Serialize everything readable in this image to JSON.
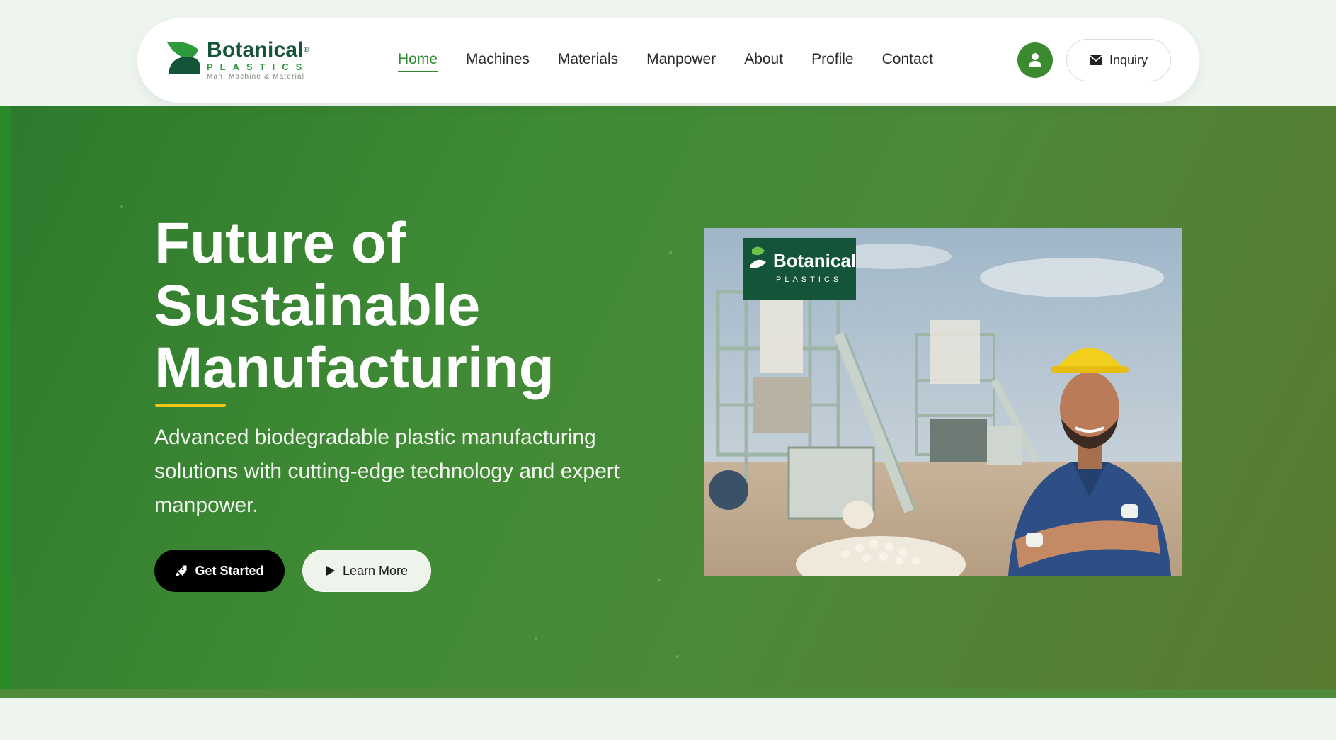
{
  "brand": {
    "name": "Botanical",
    "registered_mark": "®",
    "sub": "PLASTICS",
    "tagline": "Man, Machine & Material",
    "color_primary": "#16553a",
    "color_accent": "#2e9a3d"
  },
  "nav": {
    "items": [
      {
        "label": "Home",
        "active": true
      },
      {
        "label": "Machines",
        "active": false
      },
      {
        "label": "Materials",
        "active": false
      },
      {
        "label": "Manpower",
        "active": false
      },
      {
        "label": "About",
        "active": false
      },
      {
        "label": "Profile",
        "active": false
      },
      {
        "label": "Contact",
        "active": false
      }
    ],
    "user_icon": "user-icon",
    "inquiry_label": "Inquiry",
    "inquiry_icon": "envelope-icon"
  },
  "hero": {
    "title_lines": [
      "Future of",
      "Sustainable",
      "Manufacturing"
    ],
    "subtitle": "Advanced biodegradable plastic manufacturing solutions with cutting-edge technology and expert manpower.",
    "primary_button": {
      "label": "Get Started",
      "icon": "rocket-icon"
    },
    "secondary_button": {
      "label": "Learn More",
      "icon": "play-icon"
    },
    "accent_color": "#f2c318",
    "image": {
      "sign_name": "Botanical",
      "sign_sub": "PLASTICS"
    }
  }
}
